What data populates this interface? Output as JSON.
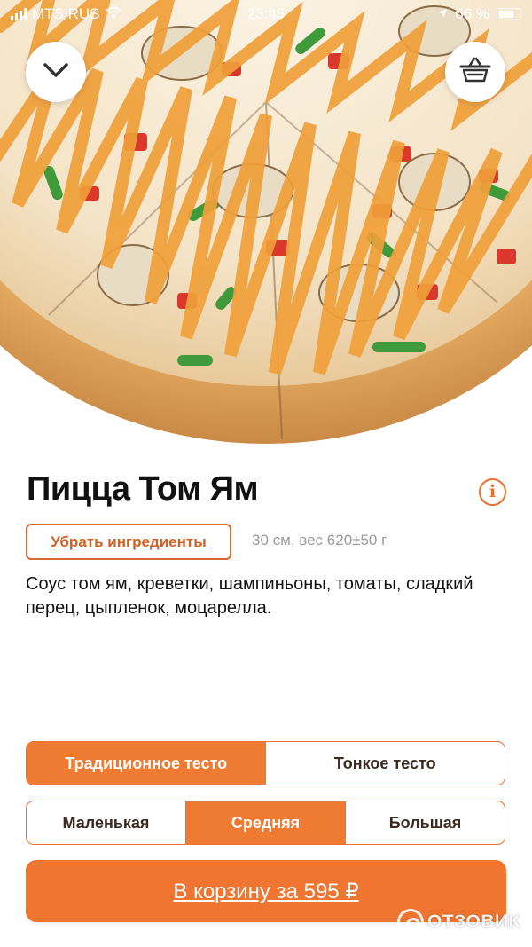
{
  "status_bar": {
    "carrier": "MTS RUS",
    "time": "23:45",
    "battery": "66 %"
  },
  "header": {
    "collapse_icon": "chevron-down-icon",
    "cart_icon": "basket-icon"
  },
  "product": {
    "title": "Пицца Том Ям",
    "remove_ingredients_label": "Убрать ингредиенты",
    "meta": "30 см, вес 620±50 г",
    "description": "Соус том ям, креветки, шампиньоны, томаты, сладкий перец, цыпленок, моцарелла.",
    "info_icon": "info-icon",
    "info_glyph": "i"
  },
  "dough_options": {
    "items": [
      "Традиционное тесто",
      "Тонкое тесто"
    ],
    "selected": "Традиционное тесто"
  },
  "size_options": {
    "items": [
      "Маленькая",
      "Средняя",
      "Большая"
    ],
    "selected": "Средняя"
  },
  "cta": {
    "label": "В корзину за 595 ₽"
  },
  "watermark": {
    "text": "ОТЗОВИК"
  },
  "colors": {
    "accent": "#ef7530",
    "accent_text": "#d45f22",
    "meta_text": "#9b9b9b"
  }
}
